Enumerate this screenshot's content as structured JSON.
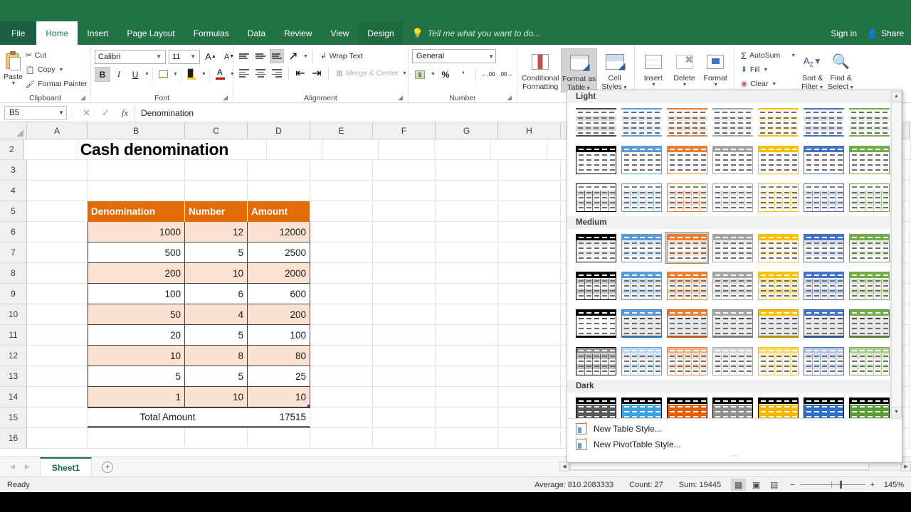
{
  "app": {
    "tabs": [
      "File",
      "Home",
      "Insert",
      "Page Layout",
      "Formulas",
      "Data",
      "Review",
      "View",
      "Design"
    ],
    "active_tab": "Home",
    "tell_me": "Tell me what you want to do...",
    "sign_in": "Sign in",
    "share": "Share"
  },
  "ribbon": {
    "clipboard": {
      "label": "Clipboard",
      "paste": "Paste",
      "cut": "Cut",
      "copy": "Copy",
      "format_painter": "Format Painter"
    },
    "font": {
      "label": "Font",
      "font_name": "Calibri",
      "font_size": "11",
      "grow": "A",
      "shrink": "A",
      "bold": "B",
      "italic": "I",
      "underline": "U"
    },
    "alignment": {
      "label": "Alignment",
      "wrap_text": "Wrap Text",
      "merge_center": "Merge & Center"
    },
    "number": {
      "label": "Number",
      "format": "General",
      "percent": "%",
      "comma": "'"
    },
    "styles": {
      "conditional_formatting": "Conditional\nFormatting",
      "conditional_formatting_l1": "Conditional",
      "conditional_formatting_l2": "Formatting",
      "format_as_table_l1": "Format as",
      "format_as_table_l2": "Table",
      "cell_styles_l1": "Cell",
      "cell_styles_l2": "Styles"
    },
    "cells": {
      "insert": "Insert",
      "delete": "Delete",
      "format": "Format"
    },
    "editing": {
      "autosum": "AutoSum",
      "fill": "Fill",
      "clear": "Clear",
      "sort_filter_l1": "Sort &",
      "sort_filter_l2": "Filter",
      "find_select_l1": "Find &",
      "find_select_l2": "Select"
    }
  },
  "formula_bar": {
    "name_box": "B5",
    "value": "Denomination"
  },
  "grid": {
    "columns": [
      "A",
      "B",
      "C",
      "D",
      "E",
      "F",
      "G",
      "H"
    ],
    "rows": [
      "2",
      "3",
      "4",
      "5",
      "6",
      "7",
      "8",
      "9",
      "10",
      "11",
      "12",
      "13",
      "14",
      "15",
      "16"
    ],
    "title": "Cash denomination",
    "table_headers": [
      "Denomination",
      "Number",
      "Amount"
    ],
    "table_rows": [
      [
        "1000",
        "12",
        "12000"
      ],
      [
        "500",
        "5",
        "2500"
      ],
      [
        "200",
        "10",
        "2000"
      ],
      [
        "100",
        "6",
        "600"
      ],
      [
        "50",
        "4",
        "200"
      ],
      [
        "20",
        "5",
        "100"
      ],
      [
        "10",
        "8",
        "80"
      ],
      [
        "5",
        "5",
        "25"
      ],
      [
        "1",
        "10",
        "10"
      ]
    ],
    "total_label": "Total Amount",
    "total_value": "17515",
    "header_fill": "#e36c0a",
    "band_fill": "#fbe2d2"
  },
  "gallery": {
    "sections": [
      {
        "name": "Light",
        "rows": [
          {
            "variant": "light-a",
            "items": [
              {
                "accent": "#4a4a4a",
                "header": "#3f3f3f",
                "band": "#d9d9d9"
              },
              {
                "accent": "#5b9bd5",
                "header": "#5b9bd5",
                "band": "#dce9f6"
              },
              {
                "accent": "#ed7d31",
                "header": "#ed7d31",
                "band": "#fbe0d0"
              },
              {
                "accent": "#a5a5a5",
                "header": "#a5a5a5",
                "band": "#ebebeb"
              },
              {
                "accent": "#ffc000",
                "header": "#ffc000",
                "band": "#fff2cc"
              },
              {
                "accent": "#4472c4",
                "header": "#4472c4",
                "band": "#d9e2f3"
              },
              {
                "accent": "#70ad47",
                "header": "#70ad47",
                "band": "#e2efd9"
              }
            ]
          },
          {
            "variant": "light-b",
            "items": [
              {
                "accent": "#000000",
                "header": "#000000",
                "band": "#ffffff"
              },
              {
                "accent": "#5b9bd5",
                "header": "#5b9bd5",
                "band": "#ffffff"
              },
              {
                "accent": "#ed7d31",
                "header": "#ed7d31",
                "band": "#ffffff"
              },
              {
                "accent": "#a5a5a5",
                "header": "#a5a5a5",
                "band": "#ffffff"
              },
              {
                "accent": "#ffc000",
                "header": "#ffc000",
                "band": "#ffffff"
              },
              {
                "accent": "#4472c4",
                "header": "#4472c4",
                "band": "#ffffff"
              },
              {
                "accent": "#70ad47",
                "header": "#70ad47",
                "band": "#ffffff"
              }
            ]
          },
          {
            "variant": "light-c",
            "items": [
              {
                "accent": "#000000",
                "header": "#ffffff",
                "band": "#d9d9d9"
              },
              {
                "accent": "#5b9bd5",
                "header": "#ffffff",
                "band": "#dce9f6"
              },
              {
                "accent": "#ed7d31",
                "header": "#ffffff",
                "band": "#fbe0d0"
              },
              {
                "accent": "#a5a5a5",
                "header": "#ffffff",
                "band": "#ebebeb"
              },
              {
                "accent": "#ffc000",
                "header": "#ffffff",
                "band": "#fff2cc"
              },
              {
                "accent": "#4472c4",
                "header": "#ffffff",
                "band": "#d9e2f3"
              },
              {
                "accent": "#70ad47",
                "header": "#ffffff",
                "band": "#e2efd9"
              }
            ]
          }
        ]
      },
      {
        "name": "Medium",
        "rows": [
          {
            "variant": "med-a",
            "selected_index": 2,
            "items": [
              {
                "accent": "#000000",
                "header": "#000000",
                "band": "#e8e8e8"
              },
              {
                "accent": "#5b9bd5",
                "header": "#5b9bd5",
                "band": "#dce9f6"
              },
              {
                "accent": "#ed7d31",
                "header": "#ed7d31",
                "band": "#fbe0d0"
              },
              {
                "accent": "#a5a5a5",
                "header": "#a5a5a5",
                "band": "#ebebeb"
              },
              {
                "accent": "#ffc000",
                "header": "#ffc000",
                "band": "#fff2cc"
              },
              {
                "accent": "#4472c4",
                "header": "#4472c4",
                "band": "#d9e2f3"
              },
              {
                "accent": "#70ad47",
                "header": "#70ad47",
                "band": "#e2efd9"
              }
            ]
          },
          {
            "variant": "med-b",
            "items": [
              {
                "accent": "#000000",
                "header": "#000000",
                "band": "#c9c9c9"
              },
              {
                "accent": "#5b9bd5",
                "header": "#5b9bd5",
                "band": "#cfe2f3"
              },
              {
                "accent": "#ed7d31",
                "header": "#ed7d31",
                "band": "#f8d5bd"
              },
              {
                "accent": "#a5a5a5",
                "header": "#a5a5a5",
                "band": "#dedede"
              },
              {
                "accent": "#ffc000",
                "header": "#ffc000",
                "band": "#ffe699"
              },
              {
                "accent": "#4472c4",
                "header": "#4472c4",
                "band": "#c6d3ec"
              },
              {
                "accent": "#70ad47",
                "header": "#70ad47",
                "band": "#d5e7c6"
              }
            ]
          },
          {
            "variant": "med-c",
            "items": [
              {
                "accent": "#000000",
                "header": "#000000",
                "band": "#ffffff"
              },
              {
                "accent": "#2e75b6",
                "header": "#5b9bd5",
                "band": "#e8e8e8"
              },
              {
                "accent": "#c55a11",
                "header": "#ed7d31",
                "band": "#e8e8e8"
              },
              {
                "accent": "#7f7f7f",
                "header": "#a5a5a5",
                "band": "#e8e8e8"
              },
              {
                "accent": "#bf9000",
                "header": "#ffc000",
                "band": "#e8e8e8"
              },
              {
                "accent": "#2f5597",
                "header": "#4472c4",
                "band": "#e8e8e8"
              },
              {
                "accent": "#538135",
                "header": "#70ad47",
                "band": "#e8e8e8"
              }
            ]
          },
          {
            "variant": "med-d",
            "items": [
              {
                "accent": "#000000",
                "header": "#8f8f8f",
                "band": "#bfbfbf"
              },
              {
                "accent": "#5b9bd5",
                "header": "#bdd7ee",
                "band": "#dce9f6"
              },
              {
                "accent": "#ed7d31",
                "header": "#f4b183",
                "band": "#fbe0d0"
              },
              {
                "accent": "#a5a5a5",
                "header": "#d6d6d6",
                "band": "#ebebeb"
              },
              {
                "accent": "#ffc000",
                "header": "#ffd966",
                "band": "#fff2cc"
              },
              {
                "accent": "#4472c4",
                "header": "#b4c6e7",
                "band": "#d9e2f3"
              },
              {
                "accent": "#70ad47",
                "header": "#a9d08e",
                "band": "#e2efd9"
              }
            ]
          }
        ]
      },
      {
        "name": "Dark",
        "rows": [
          {
            "variant": "dark-a",
            "items": [
              {
                "accent": "#000000",
                "header": "#000000",
                "band": "#595959"
              },
              {
                "accent": "#000000",
                "header": "#000000",
                "band": "#41a0e0"
              },
              {
                "accent": "#000000",
                "header": "#000000",
                "band": "#e2600c"
              },
              {
                "accent": "#000000",
                "header": "#000000",
                "band": "#8f8f8f"
              },
              {
                "accent": "#000000",
                "header": "#000000",
                "band": "#f2b800"
              },
              {
                "accent": "#000000",
                "header": "#000000",
                "band": "#2f6fc4"
              },
              {
                "accent": "#000000",
                "header": "#000000",
                "band": "#5a9c36"
              }
            ]
          }
        ]
      }
    ],
    "new_table_style": "New Table Style...",
    "new_pivot_style": "New PivotTable Style..."
  },
  "sheet_bar": {
    "sheet_name": "Sheet1",
    "add_sheet": "+"
  },
  "status_bar": {
    "ready": "Ready",
    "average": "Average: 810.2083333",
    "count": "Count: 27",
    "sum": "Sum: 19445",
    "zoom": "145%"
  }
}
